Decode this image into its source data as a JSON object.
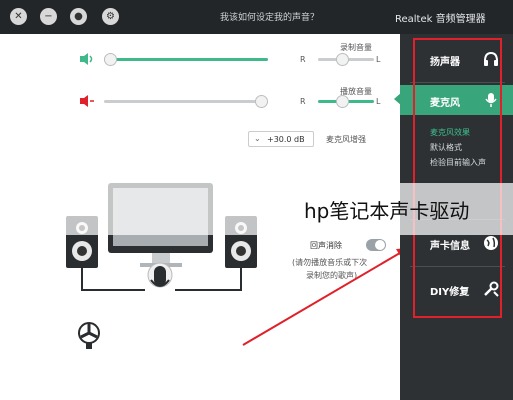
{
  "title_bar": {
    "app_title": "Realtek 音频管理器",
    "help_text": "我该如何设定我的声音？",
    "btn_settings_icon": "gear-icon",
    "btn_chat_icon": "chat-icon",
    "btn_minimize_icon": "minus-icon",
    "btn_close_icon": "close-icon"
  },
  "sidebar": {
    "items": [
      {
        "label": "扬声器",
        "icon": "headphones-icon"
      },
      {
        "label": "麦克风",
        "icon": "microphone-icon"
      },
      {
        "label": "声卡信息",
        "icon": "globe-icon"
      },
      {
        "label": "DIY修复",
        "icon": "tools-icon"
      }
    ],
    "sub_items": [
      "麦克风效果",
      "默认格式",
      "检验目前输入声"
    ]
  },
  "playback": {
    "label": "录制音量",
    "left_label": "L",
    "right_label": "R",
    "level_percent": 46
  },
  "monitor": {
    "label": "播放音量",
    "left_label": "L",
    "right_label": "R",
    "level_percent": 0
  },
  "boost": {
    "label": "麦克风增强",
    "value": "+30.0 dB"
  },
  "echo": {
    "label": "回声消除",
    "note": "(请勿播放音乐或录制您的歌声)",
    "note_line1": "(请勿播放音乐或下次",
    "note_line2": "录制您的歌声)"
  },
  "overlay": {
    "caption": "hp笔记本声卡驱动"
  },
  "colors": {
    "accent": "#3fb88a",
    "titlebar": "#232628",
    "sidebar": "#2d3134",
    "highlight_box": "#e0202a"
  }
}
